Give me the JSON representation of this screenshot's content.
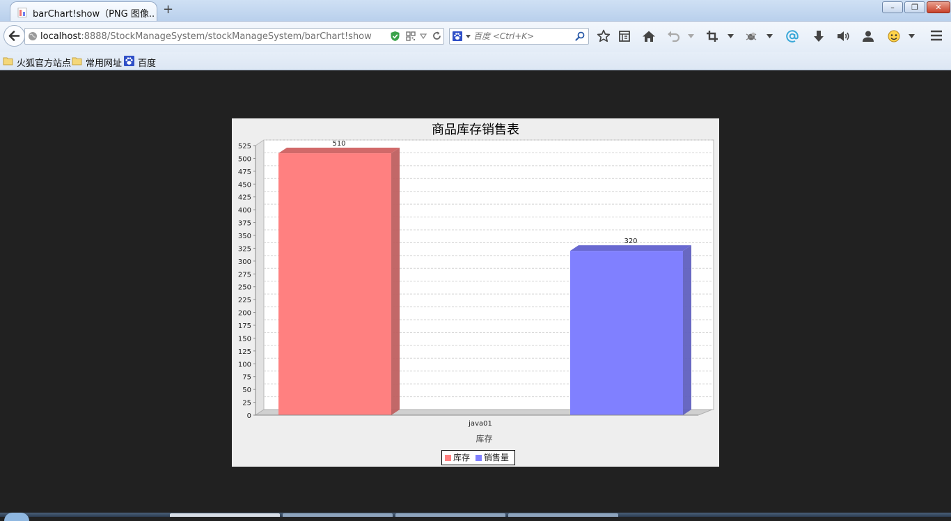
{
  "browser": {
    "tab": {
      "title": "barChart!show（PNG 图像..."
    },
    "new_tab_label": "+",
    "window_controls": {
      "minimize": "–",
      "maximize": "❐",
      "close": "✕"
    },
    "url": {
      "host": "localhost",
      "rest": ":8888/StockManageSystem/stockManageSystem/barChart!show"
    },
    "search": {
      "placeholder": "百度 <Ctrl+K>"
    },
    "toolbar_icons": [
      "bookmark-star-icon",
      "reading-list-icon",
      "home-icon",
      "undo-icon",
      "crop-icon",
      "bug-icon",
      "at-icon",
      "download-icon",
      "volume-icon",
      "user-icon",
      "emoji-icon",
      "menu-icon"
    ],
    "bookmarks": [
      {
        "label": "火狐官方站点",
        "icon": "folder-icon"
      },
      {
        "label": "常用网址",
        "icon": "folder-icon"
      },
      {
        "label": "百度",
        "icon": "baidu-paw-icon"
      }
    ]
  },
  "colors": {
    "page_background": "#212121",
    "chart_background": "#eeeeee",
    "series_stock": "#ff8080",
    "series_sales": "#8080ff"
  },
  "chart_data": {
    "type": "bar",
    "title": "商品库存销售表",
    "xlabel": "库存",
    "ylabel": "",
    "categories": [
      "java01"
    ],
    "series": [
      {
        "name": "库存",
        "values": [
          510
        ]
      },
      {
        "name": "销售量",
        "values": [
          320
        ]
      }
    ],
    "data_labels": [
      "510",
      "320"
    ],
    "ylim": [
      0,
      525
    ],
    "yticks": [
      0,
      25,
      50,
      75,
      100,
      125,
      150,
      175,
      200,
      225,
      250,
      275,
      300,
      325,
      350,
      375,
      400,
      425,
      450,
      475,
      500,
      525
    ],
    "grid": true,
    "three_d": true,
    "legend_position": "bottom"
  }
}
